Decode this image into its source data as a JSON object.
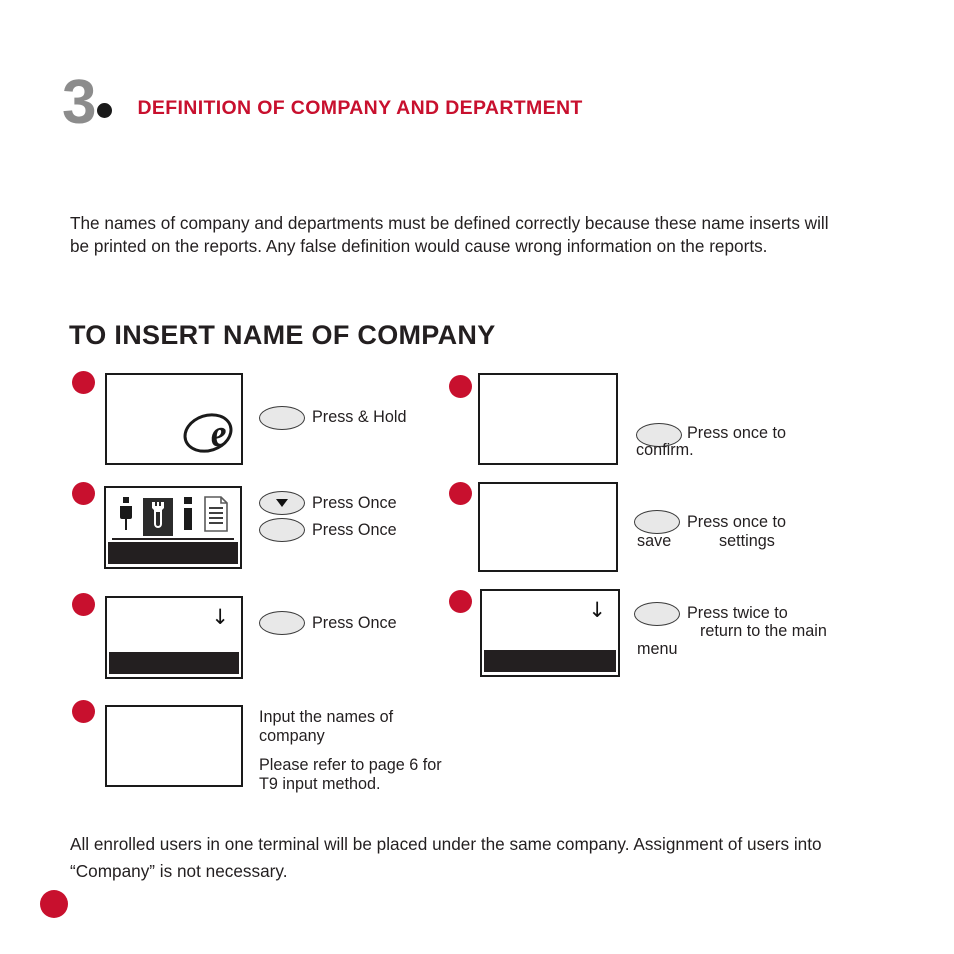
{
  "chapter": {
    "number": "3",
    "title": "DEFINITION OF COMPANY AND DEPARTMENT",
    "bullet_icon": "black-dot-icon",
    "number_color": "#8c8c8c",
    "title_color": "#c8102e"
  },
  "intro_paragraph": "The names of company and departments must be defined correctly because these name inserts will be printed on the reports. Any false definition would cause wrong information on the reports.",
  "section_heading": "TO INSERT NAME OF COMPANY",
  "closing_paragraph": "All enrolled users in one terminal will be placed under the same company. Assignment of users into “Company” is not necessary.",
  "accent_color": "#c8102e",
  "left_steps": [
    {
      "screen": {
        "content": "e-logo",
        "has_black_bar": false,
        "has_down_arrow": false
      },
      "buttons": [
        {
          "glyph": "none",
          "label": "Press & Hold"
        }
      ]
    },
    {
      "screen": {
        "content": "icon-row",
        "icons": [
          {
            "name": "user-icon",
            "selected": false
          },
          {
            "name": "wrench-settings-icon",
            "selected": true
          },
          {
            "name": "info-icon",
            "selected": false
          },
          {
            "name": "report-document-icon",
            "selected": false
          }
        ],
        "has_black_bar": true,
        "has_separator": true,
        "has_down_arrow": false
      },
      "buttons": [
        {
          "glyph": "down-triangle",
          "label": "Press Once"
        },
        {
          "glyph": "none",
          "label": "Press Once"
        }
      ]
    },
    {
      "screen": {
        "content": "blank",
        "has_black_bar": true,
        "has_down_arrow": true
      },
      "buttons": [
        {
          "glyph": "none",
          "label": "Press Once"
        }
      ]
    },
    {
      "screen": {
        "content": "blank",
        "has_black_bar": false,
        "has_down_arrow": false
      },
      "caption_lines": [
        "Input the names of\ncompany",
        "Please refer to page 6\nfor T9 input method."
      ]
    }
  ],
  "right_steps": [
    {
      "screen": {
        "content": "blank",
        "has_black_bar": false,
        "has_down_arrow": false
      },
      "button": {
        "glyph": "none"
      },
      "label_main": "Press once to",
      "label_below": "confirm.",
      "label_tail": ""
    },
    {
      "screen": {
        "content": "blank",
        "has_black_bar": false,
        "has_down_arrow": false
      },
      "button": {
        "glyph": "none"
      },
      "label_main": "Press once to",
      "label_below": "save",
      "label_tail": "settings"
    },
    {
      "screen": {
        "content": "blank",
        "has_black_bar": true,
        "has_down_arrow": true
      },
      "button": {
        "glyph": "none"
      },
      "label_main": "Press twice to",
      "label_second": "return to the main",
      "label_below": "menu",
      "label_tail": ""
    }
  ]
}
